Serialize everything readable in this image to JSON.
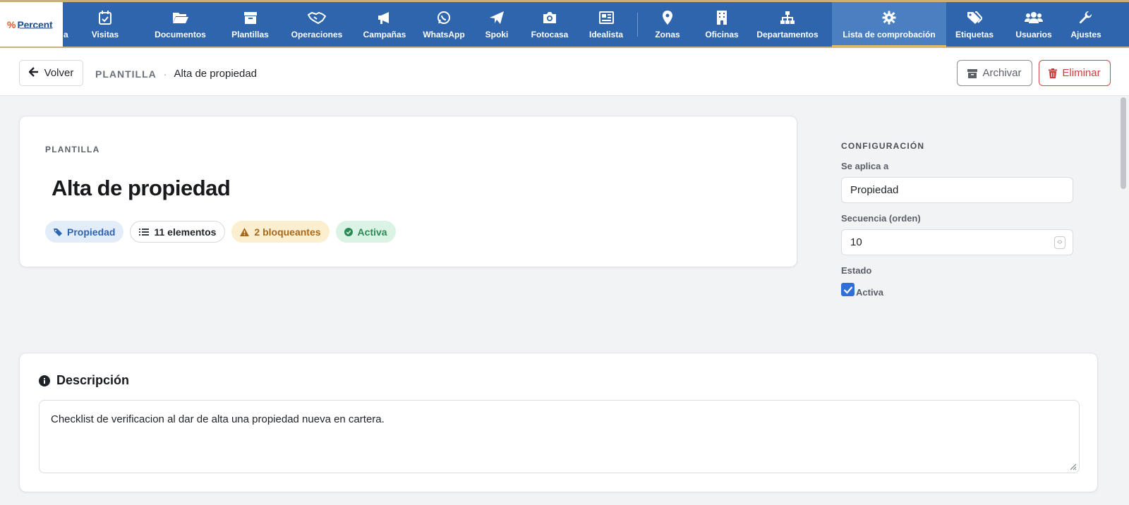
{
  "brand": {
    "name": "Percent",
    "mark": "%"
  },
  "nav": {
    "cut_label": "a",
    "items": [
      {
        "label": "Visitas",
        "icon": "calendar-check-icon"
      },
      {
        "label": "Documentos",
        "icon": "folder-open-icon"
      },
      {
        "label": "Plantillas",
        "icon": "archive-box-icon"
      },
      {
        "label": "Operaciones",
        "icon": "handshake-icon"
      },
      {
        "label": "Campañas",
        "icon": "megaphone-icon"
      },
      {
        "label": "WhatsApp",
        "icon": "whatsapp-icon"
      },
      {
        "label": "Spoki",
        "icon": "paper-plane-icon"
      },
      {
        "label": "Fotocasa",
        "icon": "camera-icon"
      },
      {
        "label": "Idealista",
        "icon": "newspaper-icon"
      },
      {
        "label": "Zonas",
        "icon": "map-pin-icon"
      },
      {
        "label": "Oficinas",
        "icon": "building-icon"
      },
      {
        "label": "Departamentos",
        "icon": "sitemap-icon"
      },
      {
        "label": "Lista de comprobación",
        "icon": "gear-icon",
        "active": true
      },
      {
        "label": "Etiquetas",
        "icon": "tags-icon"
      },
      {
        "label": "Usuarios",
        "icon": "users-icon"
      },
      {
        "label": "Ajustes",
        "icon": "wrench-icon"
      }
    ]
  },
  "header": {
    "back_label": "Volver",
    "breadcrumb_section": "PLANTILLA",
    "breadcrumb_separator": "·",
    "breadcrumb_current": "Alta de propiedad",
    "archive_label": "Archivar",
    "delete_label": "Eliminar"
  },
  "template": {
    "eyebrow": "PLANTILLA",
    "title": "Alta de propiedad",
    "chips": {
      "type": "Propiedad",
      "elements": "11 elementos",
      "blocking": "2 bloqueantes",
      "status": "Activa"
    }
  },
  "config": {
    "heading": "CONFIGURACIÓN",
    "applies_label": "Se aplica a",
    "applies_value": "Propiedad",
    "sequence_label": "Secuencia (orden)",
    "sequence_value": "10",
    "status_label": "Estado",
    "active_checked": true,
    "active_label": "Activa"
  },
  "description": {
    "title": "Descripción",
    "text": "Checklist de verificacion al dar de alta una propiedad nueva en cartera."
  },
  "colors": {
    "nav_bg": "#2f65ad",
    "nav_active": "#4a7fc2",
    "accent_gold": "#d9b96a",
    "danger": "#d23c3c",
    "chip_blue": "#2e63ad",
    "chip_amber": "#a8681b",
    "chip_green": "#2a8a55"
  }
}
